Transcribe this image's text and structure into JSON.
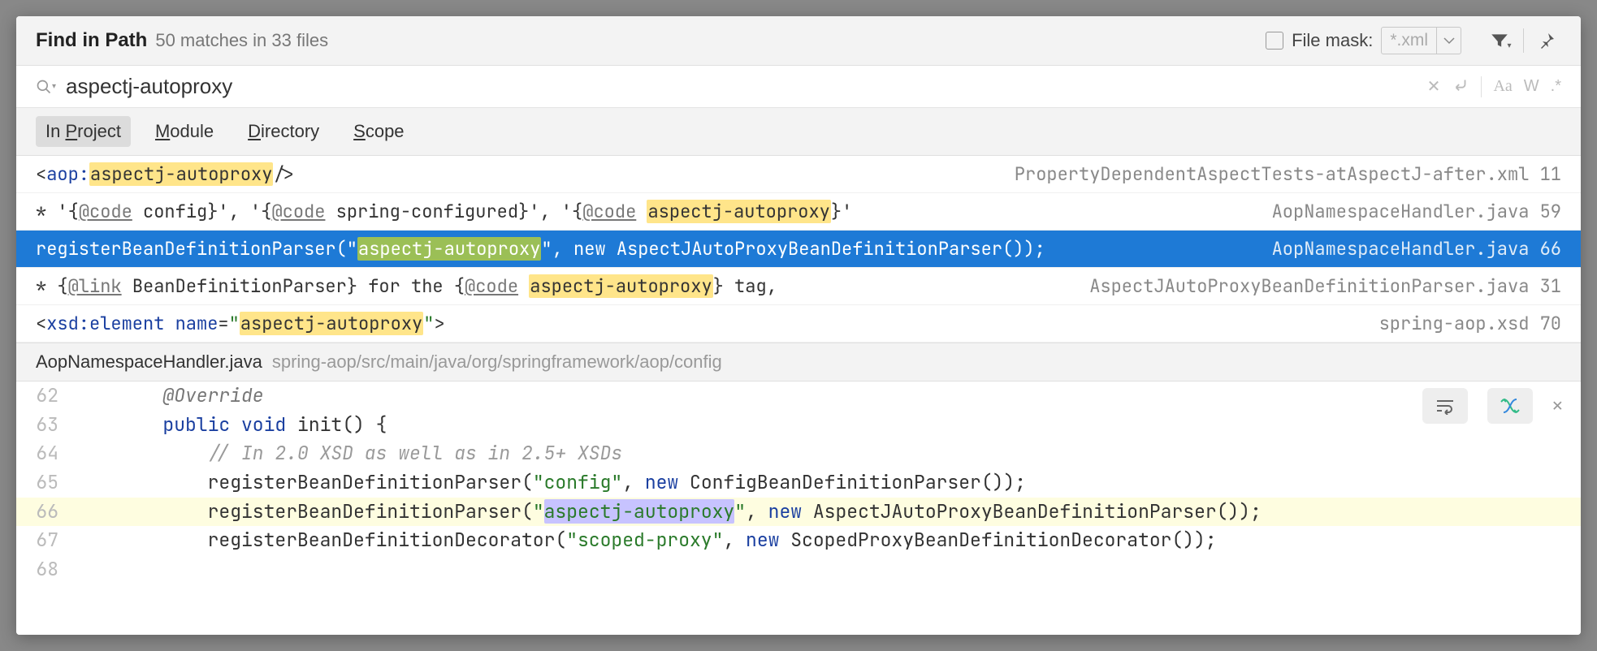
{
  "header": {
    "title": "Find in Path",
    "match_summary": "50 matches in 33 files",
    "file_mask_label": "File mask:",
    "file_mask_value": "*.xml"
  },
  "search": {
    "query": "aspectj-autoproxy",
    "case_label": "Aa",
    "words_label": "W",
    "regex_label": ".*"
  },
  "scope": {
    "tabs": [
      {
        "prefix": "In ",
        "mn": "P",
        "suffix": "roject",
        "active": true
      },
      {
        "prefix": "",
        "mn": "M",
        "suffix": "odule",
        "active": false
      },
      {
        "prefix": "",
        "mn": "D",
        "suffix": "irectory",
        "active": false
      },
      {
        "prefix": "",
        "mn": "S",
        "suffix": "cope",
        "active": false
      }
    ]
  },
  "results": [
    {
      "pre": "<aop:",
      "match": "aspectj-autoproxy",
      "post": "/>",
      "file": "PropertyDependentAspectTests-atAspectJ-after.xml",
      "line": "11",
      "selected": false,
      "xml": true
    },
    {
      "pre": "* '{@code config}', '{@code spring-configured}', '{@code ",
      "match": "aspectj-autoproxy",
      "post": "}'",
      "file": "AopNamespaceHandler.java",
      "line": "59",
      "selected": false
    },
    {
      "pre": "registerBeanDefinitionParser(\"",
      "match": "aspectj-autoproxy",
      "post": "\", new AspectJAutoProxyBeanDefinitionParser());",
      "file": "AopNamespaceHandler.java",
      "line": "66",
      "selected": true
    },
    {
      "pre": "* {@link BeanDefinitionParser} for the {@code ",
      "match": "aspectj-autoproxy",
      "post": "} tag,",
      "file": "AspectJAutoProxyBeanDefinitionParser.java",
      "line": "31",
      "selected": false
    },
    {
      "pre": "<xsd:element name=\"",
      "match": "aspectj-autoproxy",
      "post": "\">",
      "file": "spring-aop.xsd",
      "line": "70",
      "selected": false,
      "xsd": true
    }
  ],
  "preview": {
    "file": "AopNamespaceHandler.java",
    "path": "spring-aop/src/main/java/org/springframework/aop/config",
    "lines": [
      {
        "n": "62",
        "kind": "ov",
        "text": "@Override",
        "indent": "        "
      },
      {
        "n": "63",
        "kind": "sig",
        "text_pre": "public void",
        "text_post": " init() {",
        "indent": "        "
      },
      {
        "n": "64",
        "kind": "cmt",
        "text": "// In 2.0 XSD as well as in 2.5+ XSDs",
        "indent": "            "
      },
      {
        "n": "65",
        "kind": "reg",
        "call": "registerBeanDefinitionParser",
        "str": "config",
        "kw": "new",
        "cls": "ConfigBeanDefinitionParser",
        "indent": "            "
      },
      {
        "n": "66",
        "kind": "reg",
        "call": "registerBeanDefinitionParser",
        "str": "aspectj-autoproxy",
        "kw": "new",
        "cls": "AspectJAutoProxyBeanDefinitionParser",
        "indent": "            ",
        "current": true,
        "hl": true
      },
      {
        "n": "67",
        "kind": "reg",
        "call": "registerBeanDefinitionDecorator",
        "str": "scoped-proxy",
        "kw": "new",
        "cls": "ScopedProxyBeanDefinitionDecorator",
        "indent": "            "
      },
      {
        "n": "68",
        "kind": "blank",
        "text": "",
        "indent": ""
      }
    ]
  }
}
